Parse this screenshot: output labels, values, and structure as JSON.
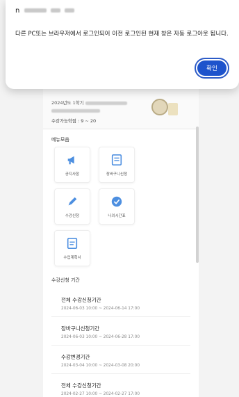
{
  "dialog": {
    "title_prefix": "n",
    "message": "다른 PC또는 브라우저에서 로그인되어 이전 로그인된 현재 창은 자동 로그아웃 됩니다.",
    "confirm_label": "확인"
  },
  "student": {
    "term_prefix": "2024년도 1학기",
    "credits": "수강가능학점 : 9 ~ 20"
  },
  "menu": {
    "title": "메뉴모음",
    "items": [
      {
        "label": "공지사항",
        "icon": "megaphone-icon"
      },
      {
        "label": "장바구니신청",
        "icon": "cart-list-icon"
      },
      {
        "label": "수강신청",
        "icon": "pencil-icon"
      },
      {
        "label": "나의시간표",
        "icon": "check-circle-icon"
      },
      {
        "label": "수업계획서",
        "icon": "document-icon"
      }
    ]
  },
  "periods": {
    "title": "수강신청 기간",
    "items": [
      {
        "name": "전체 수강신청기간",
        "date": "2024-06-03 10:00 ~ 2024-06-14 17:00"
      },
      {
        "name": "장바구니신청기간",
        "date": "2024-06-03 10:00 ~ 2024-06-28 17:00"
      },
      {
        "name": "수강변경기간",
        "date": "2024-03-04 10:00 ~ 2024-03-08 20:00"
      },
      {
        "name": "전체 수강신청기간",
        "date": "2024-02-27 10:00 ~ 2024-02-27 17:00"
      }
    ]
  },
  "colors": {
    "primary": "#1d53cc",
    "accent_line": "#1f63c6",
    "icon_blue": "#4d8fe0"
  }
}
